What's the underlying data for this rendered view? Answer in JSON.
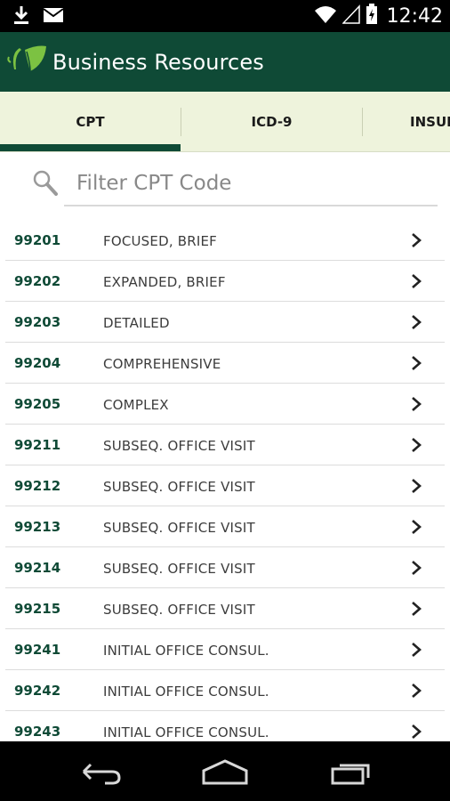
{
  "status_bar": {
    "time": "12:42",
    "icons": [
      "download-icon",
      "mail-icon",
      "wifi-icon",
      "signal-icon",
      "battery-icon"
    ]
  },
  "app": {
    "title": "Business Resources"
  },
  "tabs": [
    {
      "label": "CPT",
      "selected": true
    },
    {
      "label": "ICD-9",
      "selected": false
    },
    {
      "label": "INSUR",
      "selected": false
    }
  ],
  "search": {
    "placeholder": "Filter CPT Code",
    "value": ""
  },
  "codes": [
    {
      "code": "99201",
      "description": "FOCUSED, BRIEF"
    },
    {
      "code": "99202",
      "description": "EXPANDED, BRIEF"
    },
    {
      "code": "99203",
      "description": "DETAILED"
    },
    {
      "code": "99204",
      "description": "COMPREHENSIVE"
    },
    {
      "code": "99205",
      "description": "COMPLEX"
    },
    {
      "code": "99211",
      "description": "SUBSEQ. OFFICE VISIT"
    },
    {
      "code": "99212",
      "description": "SUBSEQ. OFFICE VISIT"
    },
    {
      "code": "99213",
      "description": "SUBSEQ. OFFICE VISIT"
    },
    {
      "code": "99214",
      "description": "SUBSEQ. OFFICE VISIT"
    },
    {
      "code": "99215",
      "description": "SUBSEQ. OFFICE VISIT"
    },
    {
      "code": "99241",
      "description": "INITIAL OFFICE CONSUL."
    },
    {
      "code": "99242",
      "description": "INITIAL OFFICE CONSUL."
    },
    {
      "code": "99243",
      "description": "INITIAL OFFICE CONSUL."
    }
  ],
  "nav_bar": {
    "buttons": [
      "back-icon",
      "home-icon",
      "recent-apps-icon"
    ]
  },
  "colors": {
    "primary": "#0f4a36",
    "tab_background": "#eef3dc",
    "code_text": "#0f4a36",
    "logo_green": "#7cc242"
  }
}
